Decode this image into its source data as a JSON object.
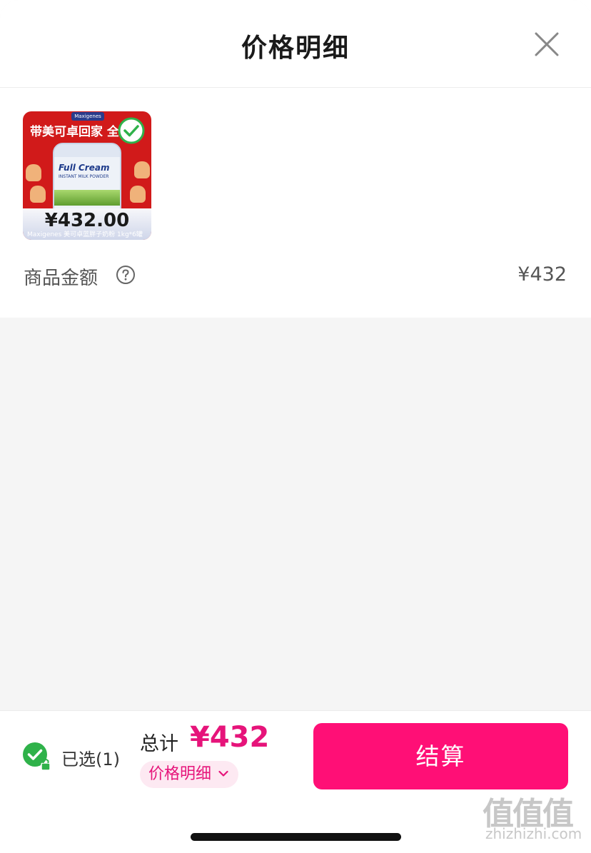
{
  "header": {
    "title": "价格明细",
    "close_icon": "close-icon"
  },
  "product": {
    "banner": "带美可卓回家 全家",
    "brand_small": "Maxigenes",
    "can_title": "Full Cream",
    "can_sub": "INSTANT MILK POWDER",
    "price": "¥432.00",
    "footer_text": "Maxigenes 美可卓蓝胖子奶粉 1kg*6罐",
    "selected": true
  },
  "summary": {
    "label": "商品金额",
    "value": "¥432",
    "help_icon": "help-circle-icon"
  },
  "footer": {
    "selected_text": "已选(1)",
    "total_label": "总计",
    "total_value": "¥432",
    "detail_label": "价格明细",
    "checkout_label": "结算"
  },
  "watermark": {
    "glyphs": "值值值",
    "site": "zhizhizhi.com"
  },
  "colors": {
    "accent": "#ff0f76",
    "price_pink": "#e6147a",
    "check_green": "#2fb24a"
  }
}
